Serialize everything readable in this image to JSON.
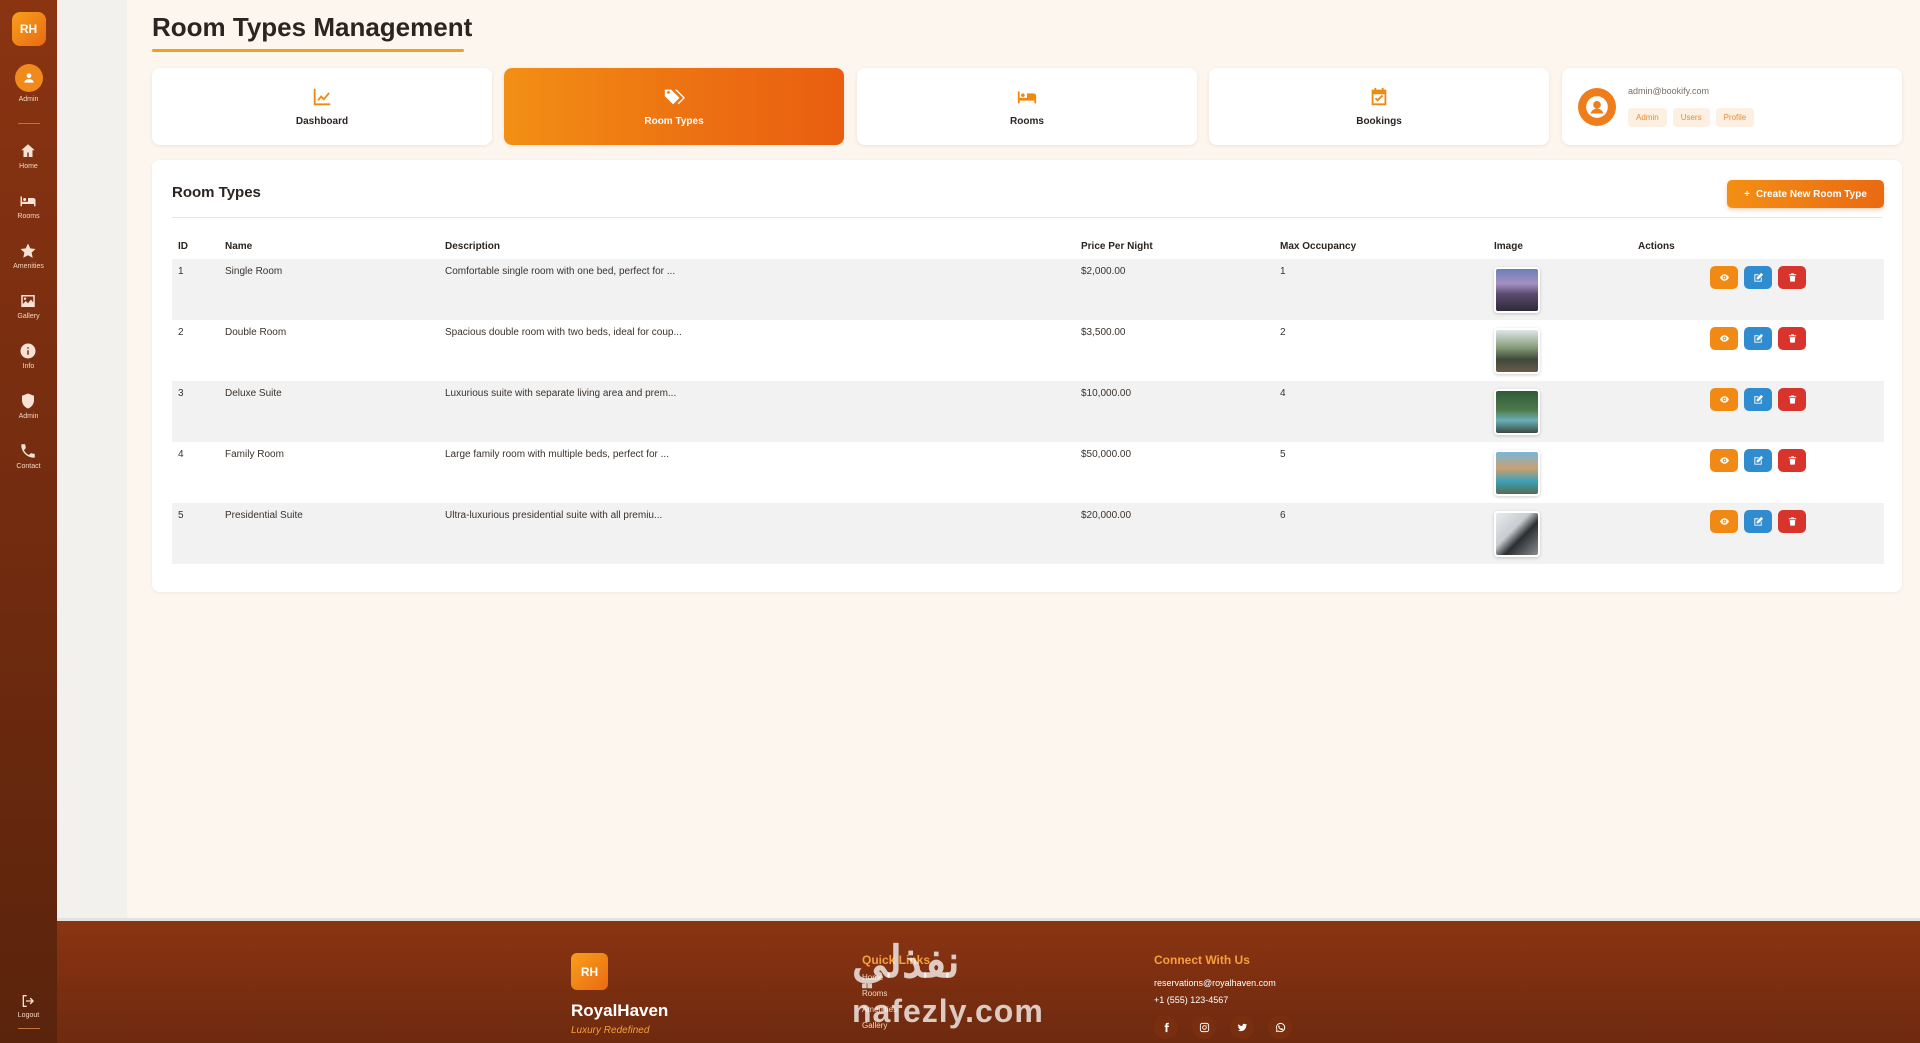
{
  "sidebar": {
    "logo": "RH",
    "user_label": "Admin",
    "items": [
      {
        "label": "Home"
      },
      {
        "label": "Rooms"
      },
      {
        "label": "Amenities"
      },
      {
        "label": "Gallery"
      },
      {
        "label": "Info"
      },
      {
        "label": "Admin"
      },
      {
        "label": "Contact"
      }
    ],
    "logout": "Logout"
  },
  "page": {
    "title": "Room Types Management"
  },
  "nav_cards": [
    {
      "label": "Dashboard",
      "icon": "chart-line-icon"
    },
    {
      "label": "Room Types",
      "icon": "tags-icon",
      "active": true
    },
    {
      "label": "Rooms",
      "icon": "bed-icon"
    },
    {
      "label": "Bookings",
      "icon": "calendar-check-icon"
    }
  ],
  "profile": {
    "email": "admin@bookify.com",
    "tags": [
      "Admin",
      "Users",
      "Profile"
    ]
  },
  "panel": {
    "title": "Room Types",
    "create_label": "Create New Room Type",
    "columns": [
      "ID",
      "Name",
      "Description",
      "Price Per Night",
      "Max Occupancy",
      "Image",
      "Actions"
    ],
    "rows": [
      {
        "id": "1",
        "name": "Single Room",
        "description": "Comfortable single room with one bed, perfect for ...",
        "price": "$2,000.00",
        "occupancy": "1"
      },
      {
        "id": "2",
        "name": "Double Room",
        "description": "Spacious double room with two beds, ideal for coup...",
        "price": "$3,500.00",
        "occupancy": "2"
      },
      {
        "id": "3",
        "name": "Deluxe Suite",
        "description": "Luxurious suite with separate living area and prem...",
        "price": "$10,000.00",
        "occupancy": "4"
      },
      {
        "id": "4",
        "name": "Family Room",
        "description": "Large family room with multiple beds, perfect for ...",
        "price": "$50,000.00",
        "occupancy": "5"
      },
      {
        "id": "5",
        "name": "Presidential Suite",
        "description": "Ultra-luxurious presidential suite with all premiu...",
        "price": "$20,000.00",
        "occupancy": "6"
      }
    ]
  },
  "footer": {
    "logo": "RH",
    "brand": "RoyalHaven",
    "tagline": "Luxury Redefined",
    "quick_links_title": "Quick Links",
    "quick_links": [
      "Home",
      "Rooms",
      "Amenities",
      "Gallery"
    ],
    "connect_title": "Connect With Us",
    "email": "reservations@royalhaven.com",
    "phone": "+1 (555) 123-4567",
    "watermark_ar": "نفذلي",
    "watermark_en": "nafezly.com"
  },
  "colors": {
    "accent": "#f08a14",
    "sidebar": "#7a2e10",
    "edit": "#2f8ccf",
    "delete": "#d9342b"
  }
}
